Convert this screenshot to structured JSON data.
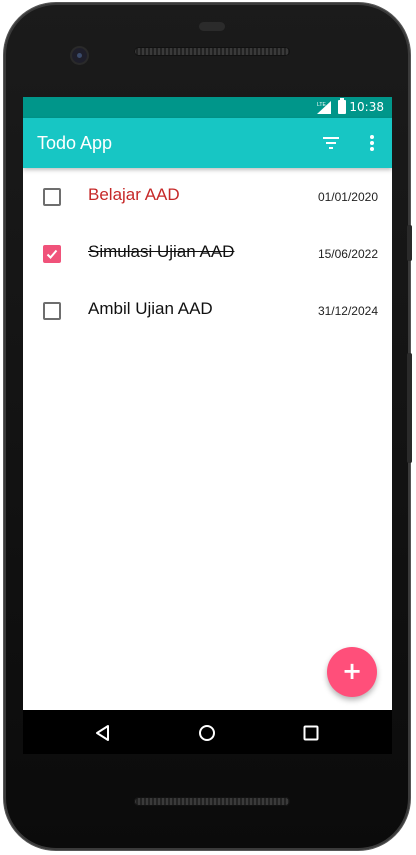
{
  "status_bar": {
    "time": "10:38",
    "network": "LTE"
  },
  "app_bar": {
    "title": "Todo App",
    "filter_icon": "filter-list-icon",
    "menu_icon": "more-vert-icon"
  },
  "todos": [
    {
      "title": "Belajar AAD",
      "date": "01/01/2020",
      "completed": false,
      "overdue": true
    },
    {
      "title": "Simulasi Ujian AAD",
      "date": "15/06/2022",
      "completed": true,
      "overdue": false
    },
    {
      "title": "Ambil Ujian AAD",
      "date": "31/12/2024",
      "completed": false,
      "overdue": false
    }
  ],
  "fab": {
    "label": "+"
  },
  "colors": {
    "status_bar": "#00968a",
    "app_bar": "#17c6c4",
    "accent": "#ff4f7a",
    "overdue_text": "#c62828"
  },
  "nav_icons": [
    "back-icon",
    "home-icon",
    "recents-icon"
  ]
}
